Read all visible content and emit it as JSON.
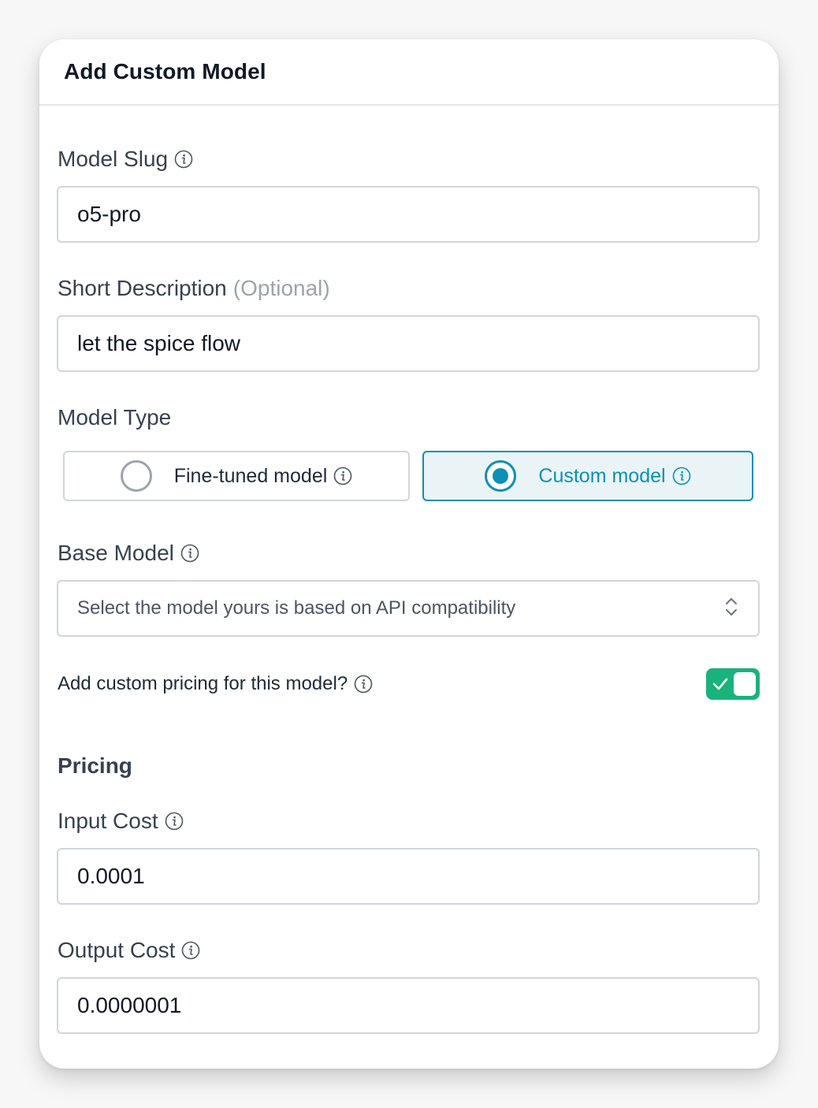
{
  "dialog": {
    "title": "Add Custom Model"
  },
  "model_slug": {
    "label": "Model Slug",
    "value": "o5-pro"
  },
  "short_description": {
    "label": "Short Description",
    "optional_tag": "(Optional)",
    "value": "let the spice flow"
  },
  "model_type": {
    "label": "Model Type",
    "options": [
      {
        "label": "Fine-tuned model",
        "selected": false
      },
      {
        "label": "Custom model",
        "selected": true
      }
    ]
  },
  "base_model": {
    "label": "Base Model",
    "placeholder": "Select the model yours is based on API compatibility"
  },
  "custom_pricing": {
    "label": "Add custom pricing for this model?",
    "enabled": true
  },
  "pricing": {
    "section_title": "Pricing",
    "input_cost": {
      "label": "Input Cost",
      "value": "0.0001"
    },
    "output_cost": {
      "label": "Output Cost",
      "value": "0.0000001"
    }
  },
  "colors": {
    "accent": "#0e8fb3",
    "selected_bg": "#eaf4f7",
    "toggle_on": "#19b27b",
    "border": "#d1d5db"
  },
  "icons": {
    "info": "info-circle-icon",
    "select": "chevron-up-down-icon",
    "toggle": "check-icon"
  }
}
